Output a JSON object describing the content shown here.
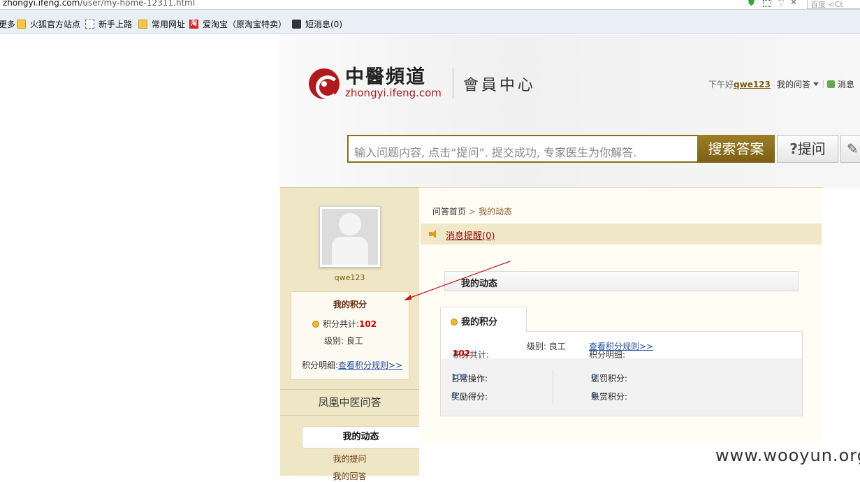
{
  "browser": {
    "url_host": "zhongyi.ifeng.com",
    "url_path": "/user/my-home-12311.html",
    "search_placeholder": "百度 <Ct",
    "bookmarks": [
      "更多",
      "火狐官方站点",
      "新手上路",
      "常用网址",
      "爱淘宝（原淘宝特卖）",
      "短消息(0)"
    ],
    "taobao_icon": "淘"
  },
  "header": {
    "logo_cn": "中醫頻道",
    "logo_en": "zhongyi.ifeng.com",
    "logo_sub": "會員中心",
    "greeting": "下午好",
    "username_link": "qwe123",
    "my_qa": "我的问答",
    "messages": "消息"
  },
  "search": {
    "placeholder": "输入问题内容, 点击“提问”. 提交成功, 专家医生为你解答.",
    "search_btn": "搜索答案",
    "ask_icon": "?",
    "ask_btn": "提问",
    "pen_icon": "✎"
  },
  "sidebar": {
    "username": "qwe123",
    "score_title": "我的积分",
    "score_label": "积分共计:",
    "score_value": "102",
    "level_label": "级别: 良工",
    "detail_label": "积分明细:",
    "detail_link": "查看积分规则>>",
    "nav_title": "凤凰中医问答",
    "nav_items": [
      "我的动态",
      "我的提问",
      "我的回答"
    ]
  },
  "main": {
    "crumb_home": "问答首页",
    "crumb_arrow": ">",
    "crumb_current": "我的动态",
    "notice_label": "消息提醒(0)",
    "section_title": "我的动态",
    "tab_label": "我的积分",
    "total_label": "积分共计:",
    "total_value": "102",
    "level": "级别: 良工",
    "detail_label": "积分明细:",
    "detail_link": "查看积分规则>>",
    "stats": {
      "daily_label": "日常操作:",
      "daily_value": "102",
      "reward_label": "奖励得分:",
      "reward_value": "0",
      "penalty_label": "惩罚积分:",
      "penalty_value": "0",
      "bounty_label": "悬赏积分:",
      "bounty_value": "0"
    }
  },
  "watermark": "www.wooyun.org",
  "colors": {
    "accent": "#8a6d1b",
    "sidebar_bg": "#efe6c6",
    "red": "#cc0000",
    "link": "#1f4f9e"
  }
}
